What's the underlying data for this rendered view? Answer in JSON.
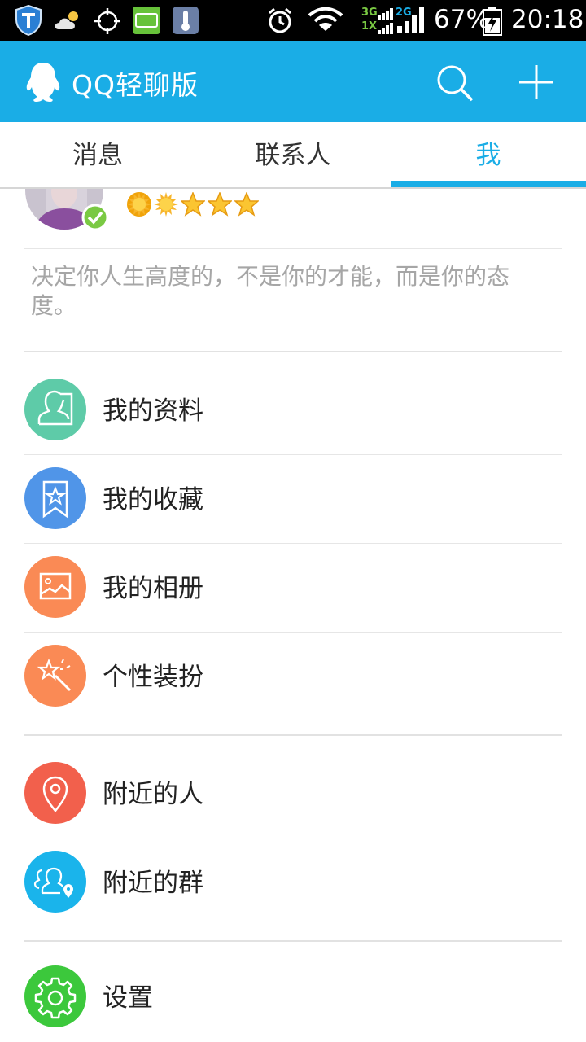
{
  "status_bar": {
    "network_labels": [
      "3G",
      "1X",
      "2G"
    ],
    "battery": "67%",
    "time": "20:18"
  },
  "header": {
    "title": "QQ轻聊版"
  },
  "tabs": [
    {
      "label": "消息",
      "active": false
    },
    {
      "label": "联系人",
      "active": false
    },
    {
      "label": "我",
      "active": true
    }
  ],
  "profile": {
    "level_icons": [
      "sun-icon",
      "sun-icon",
      "star-icon",
      "star-icon",
      "star-icon"
    ],
    "signature": "决定你人生高度的，不是你的才能，而是你的态度。"
  },
  "menu": {
    "group1": [
      {
        "label": "我的资料",
        "icon": "profile-icon",
        "color": "#5ecba8"
      },
      {
        "label": "我的收藏",
        "icon": "favorites-icon",
        "color": "#5095e8"
      },
      {
        "label": "我的相册",
        "icon": "album-icon",
        "color": "#fa8a55"
      },
      {
        "label": "个性装扮",
        "icon": "magic-wand-icon",
        "color": "#fa8a55"
      }
    ],
    "group2": [
      {
        "label": "附近的人",
        "icon": "location-icon",
        "color": "#f2604c"
      },
      {
        "label": "附近的群",
        "icon": "nearby-group-icon",
        "color": "#1ab4eb"
      }
    ],
    "group3": [
      {
        "label": "设置",
        "icon": "gear-icon",
        "color": "#3cc83c"
      }
    ]
  },
  "colors": {
    "brand": "#1aade6",
    "status_bar": "#000000",
    "verified_badge": "#7ac943"
  }
}
